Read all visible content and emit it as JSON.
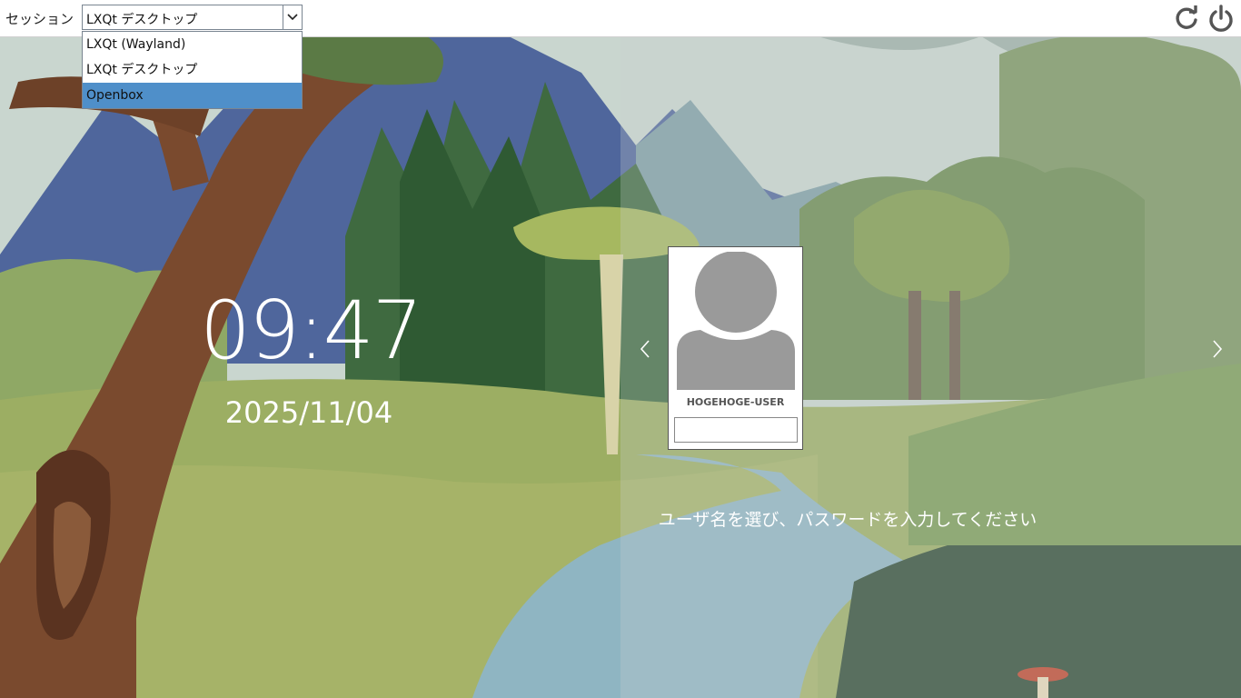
{
  "topbar": {
    "session_label": "セッション",
    "session_value": "LXQt デスクトップ",
    "session_options": [
      "LXQt (Wayland)",
      "LXQt デスクトップ",
      "Openbox"
    ],
    "selected_option": "Openbox",
    "reboot_icon": "reboot-icon",
    "power_icon": "power-icon"
  },
  "clock": {
    "time": "09:47",
    "date": "2025/11/04"
  },
  "login": {
    "username": "HOGEHOGE-USER",
    "password_value": "",
    "hint": "ユーザ名を選び、パスワードを入力してください",
    "avatar_icon": "user-avatar-icon",
    "prev_icon": "chevron-left-icon",
    "next_icon": "chevron-right-icon"
  },
  "colors": {
    "accent": "#4f8fc9",
    "avatar": "#9a9a9a"
  }
}
